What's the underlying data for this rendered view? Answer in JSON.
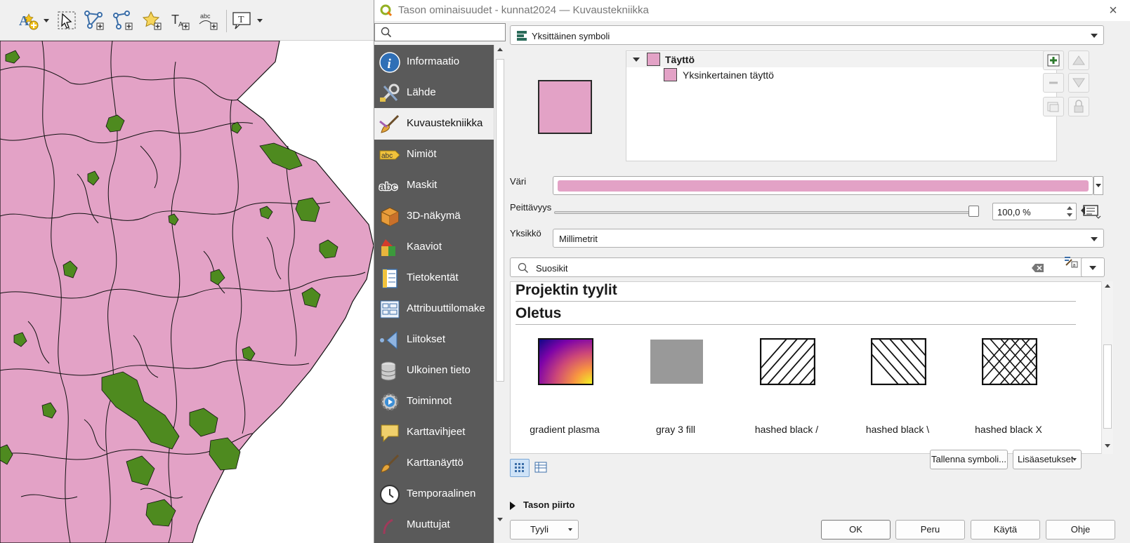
{
  "toolbar": {
    "tools": [
      "label-tool-icon",
      "select-tool-icon",
      "add-vertex-icon",
      "add-line-icon",
      "star-icon",
      "text-add-icon",
      "abc-text-icon",
      "text-annotation-icon"
    ]
  },
  "dialog": {
    "title": "Tason ominaisuudet - kunnat2024 — Kuvaustekniikka",
    "close": "×"
  },
  "nav": {
    "items": [
      {
        "label": "Informaatio",
        "icon": "info-icon"
      },
      {
        "label": "Lähde",
        "icon": "wrench-icon"
      },
      {
        "label": "Kuvaustekniikka",
        "icon": "brush-icon"
      },
      {
        "label": "Nimiöt",
        "icon": "labels-icon"
      },
      {
        "label": "Maskit",
        "icon": "mask-icon"
      },
      {
        "label": "3D-näkymä",
        "icon": "cube-icon"
      },
      {
        "label": "Kaaviot",
        "icon": "diagram-icon"
      },
      {
        "label": "Tietokentät",
        "icon": "fields-icon"
      },
      {
        "label": "Attribuuttilomake",
        "icon": "form-icon"
      },
      {
        "label": "Liitokset",
        "icon": "joins-icon"
      },
      {
        "label": "Ulkoinen tieto",
        "icon": "database-icon"
      },
      {
        "label": "Toiminnot",
        "icon": "actions-icon"
      },
      {
        "label": "Karttavihjeet",
        "icon": "tooltip-icon"
      },
      {
        "label": "Karttanäyttö",
        "icon": "brush-icon"
      },
      {
        "label": "Temporaalinen",
        "icon": "clock-icon"
      },
      {
        "label": "Muuttujat",
        "icon": "variables-icon"
      }
    ],
    "active_index": 2
  },
  "renderer": {
    "label": "Yksittäinen symboli"
  },
  "symbol_tree": {
    "root_label": "Täyttö",
    "child_label": "Yksinkertainen täyttö",
    "fill_color": "#e3a2c6"
  },
  "props": {
    "color_label": "Väri",
    "color": "#e3a2c6",
    "opacity_label": "Peittävyys",
    "opacity_value": "100,0 %",
    "opacity_fraction": 1.0,
    "unit_label": "Yksikkö",
    "unit_value": "Millimetrit"
  },
  "styles": {
    "search_value": "Suosikit",
    "groups": [
      "Projektin tyylit",
      "Oletus"
    ],
    "items": [
      {
        "name": "gradient   plasma",
        "kind": "gradient"
      },
      {
        "name": "gray 3 fill",
        "kind": "gray"
      },
      {
        "name": "hashed black /",
        "kind": "hash-forward"
      },
      {
        "name": "hashed black \\",
        "kind": "hash-back"
      },
      {
        "name": "hashed black X",
        "kind": "hash-cross"
      }
    ]
  },
  "buttons": {
    "save_symbol": "Tallenna symboli...",
    "advanced": "Lisäasetukset",
    "layer_rendering": "Tason piirto",
    "style": "Tyyli",
    "ok": "OK",
    "cancel": "Peru",
    "apply": "Käytä",
    "help": "Ohje"
  },
  "colors": {
    "map_fill": "#e3a2c6",
    "lake_fill": "#4e8a1f",
    "nav_bg": "#5a5a5a"
  }
}
